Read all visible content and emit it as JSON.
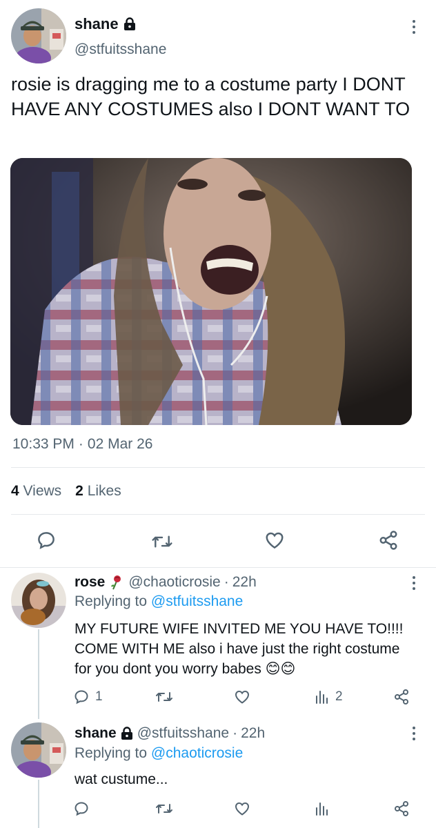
{
  "tweet": {
    "author_name": "shane",
    "author_handle": "@stfuitsshane",
    "text": "rosie is dragging me to a costume party I DONT HAVE ANY COSTUMES also I DONT WANT TO",
    "time": "10:33 PM",
    "separator": "·",
    "date": "02 Mar 26",
    "views_count": "4",
    "views_label": "Views",
    "likes_count": "2",
    "likes_label": "Likes"
  },
  "replies": [
    {
      "author_name": "rose",
      "author_handle": "@chaoticrosie",
      "separator": "·",
      "time_ago": "22h",
      "replying_prefix": "Replying to",
      "replying_to": "@stfuitsshane",
      "text": "MY FUTURE WIFE INVITED ME YOU HAVE TO!!!! COME WITH ME also i have just the right costume for you dont you worry babes 😊😊",
      "reply_count": "1",
      "views_count": "2"
    },
    {
      "author_name": "shane",
      "author_handle": "@stfuitsshane",
      "separator": "·",
      "time_ago": "22h",
      "replying_prefix": "Replying to",
      "replying_to": "@chaoticrosie",
      "text": "wat custume..."
    }
  ],
  "colors": {
    "text": "#0f1419",
    "secondary": "#536471",
    "link": "#1d9bf0",
    "divider": "#e5e8eb"
  },
  "icons": [
    "lock-icon",
    "more-icon",
    "reply-icon",
    "retweet-icon",
    "like-icon",
    "share-icon",
    "views-icon",
    "rose-emoji-icon"
  ]
}
